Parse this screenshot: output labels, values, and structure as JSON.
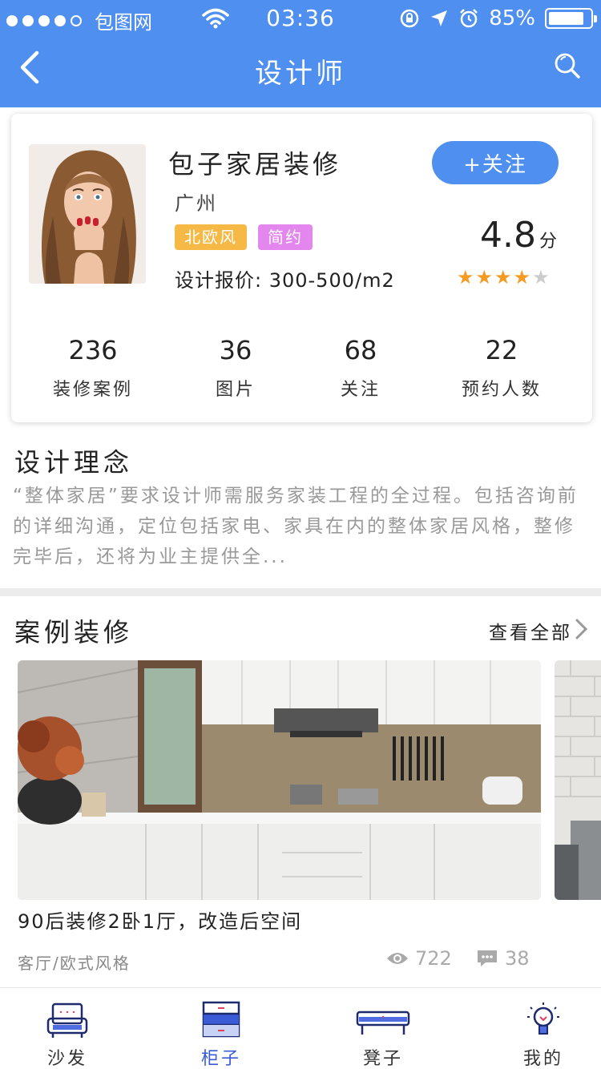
{
  "status_bar": {
    "carrier": "包图网",
    "time": "03:36",
    "battery": "85%",
    "battery_level": 0.85
  },
  "navbar": {
    "title": "设计师"
  },
  "designer": {
    "name": "包子家居装修",
    "city": "广州",
    "tags": [
      {
        "label": "北欧风",
        "color": "#f7b945"
      },
      {
        "label": "简约",
        "color": "#e387ef"
      }
    ],
    "price": "设计报价: 300-500/m2",
    "follow_label": "+关注",
    "score": "4.8",
    "score_unit": "分",
    "rating": 4,
    "rating_max": 5,
    "stats": [
      {
        "value": "236",
        "label": "装修案例"
      },
      {
        "value": "36",
        "label": "图片"
      },
      {
        "value": "68",
        "label": "关注"
      },
      {
        "value": "22",
        "label": "预约人数"
      }
    ]
  },
  "philosophy": {
    "title": "设计理念",
    "text": "“整体家居”要求设计师需服务家装工程的全过程。包括咨询前的详细沟通，定位包括家电、家具在内的整体家居风格，整修完毕后，还将为业主提供全..."
  },
  "cases": {
    "title": "案例装修",
    "view_all": "查看全部",
    "items": [
      {
        "title": "90后装修2卧1厅，改造后空间",
        "category": "客厅/欧式风格",
        "views": "722",
        "comments": "38"
      }
    ]
  },
  "tabbar": {
    "items": [
      {
        "label": "沙发",
        "icon": "sofa-icon"
      },
      {
        "label": "柜子",
        "icon": "cabinet-icon"
      },
      {
        "label": "凳子",
        "icon": "bench-icon"
      },
      {
        "label": "我的",
        "icon": "bulb-icon"
      }
    ],
    "active_index": 1
  },
  "colors": {
    "primary": "#4f8ff0",
    "star": "#f59a23",
    "tab_active": "#3a5bd6"
  }
}
